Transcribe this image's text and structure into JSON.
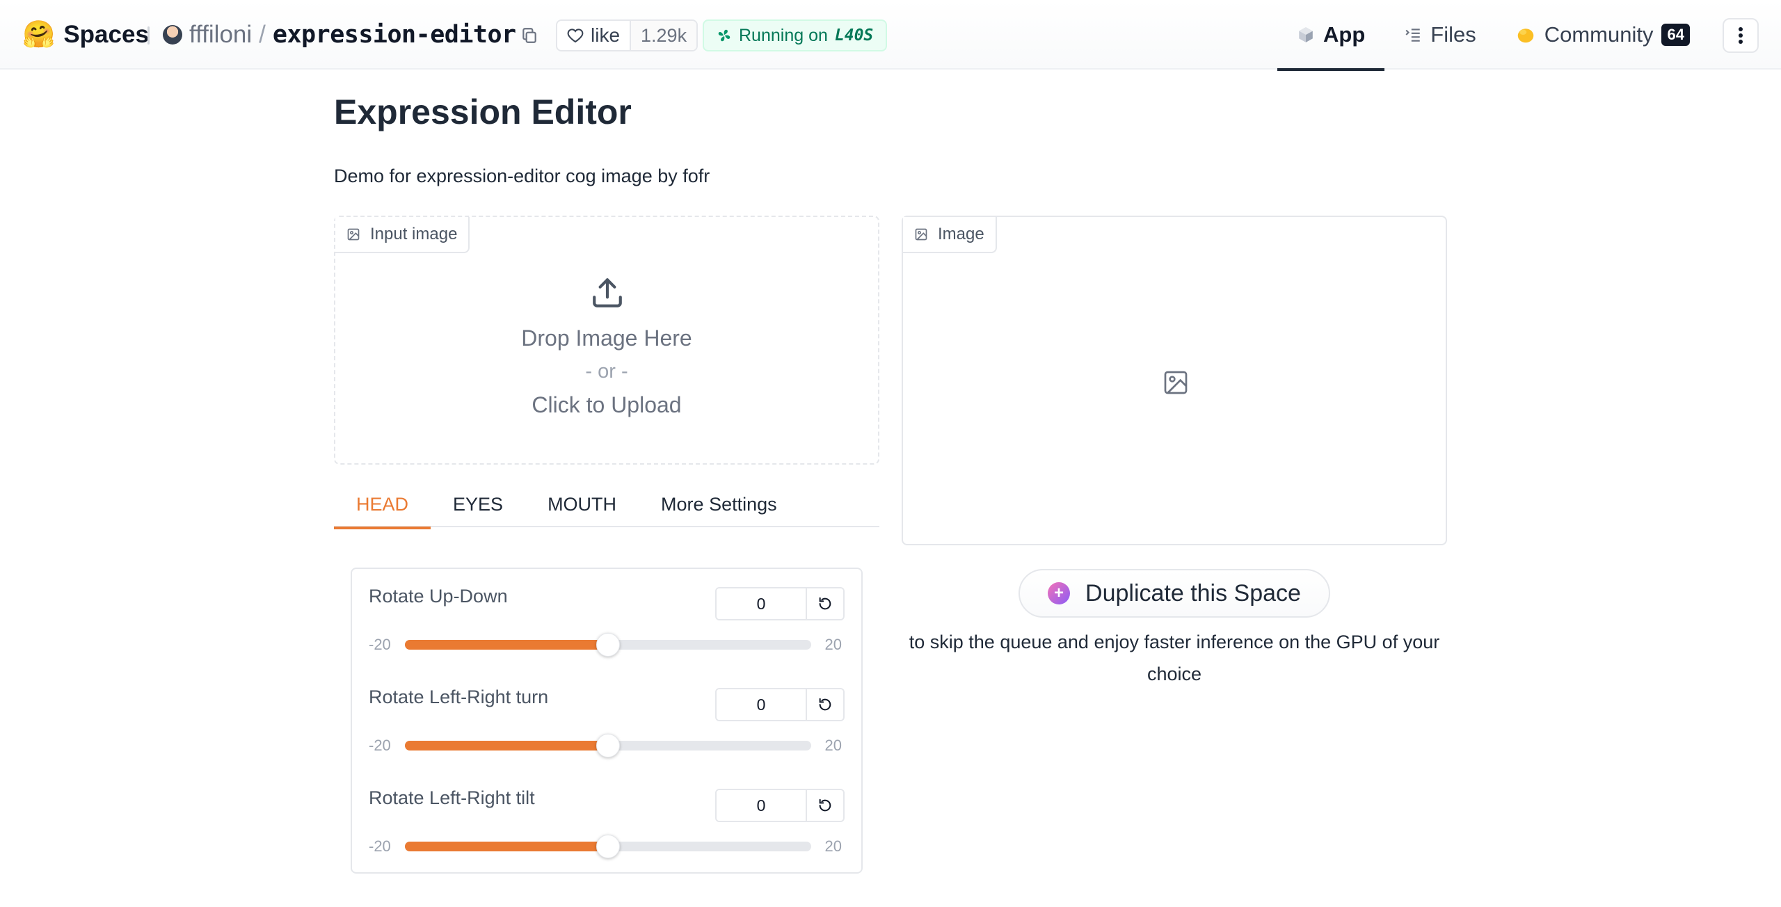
{
  "nav": {
    "brand_label": "Spaces",
    "brand_icon": "hugging-face-emoji",
    "owner": "fffiloni",
    "repo": "expression-editor",
    "like_label": "like",
    "like_count": "1.29k",
    "status_prefix": "Running on",
    "status_hardware": "L40S",
    "tabs": [
      {
        "label": "App",
        "icon": "cube-icon",
        "active": true
      },
      {
        "label": "Files",
        "icon": "files-icon",
        "active": false
      },
      {
        "label": "Community",
        "icon": "community-icon",
        "active": false,
        "badge": "64"
      }
    ]
  },
  "app": {
    "title": "Expression Editor",
    "description": "Demo for expression-editor cog image by fofr",
    "input_image": {
      "label": "Input image",
      "drop_text": "Drop Image Here",
      "or_text": "- or -",
      "click_text": "Click to Upload"
    },
    "output_image": {
      "label": "Image"
    },
    "tabs": [
      {
        "label": "HEAD",
        "active": true
      },
      {
        "label": "EYES",
        "active": false
      },
      {
        "label": "MOUTH",
        "active": false
      },
      {
        "label": "More Settings",
        "active": false
      }
    ],
    "sliders": [
      {
        "label": "Rotate Up-Down",
        "value": 0,
        "min": -20,
        "max": 20
      },
      {
        "label": "Rotate Left-Right turn",
        "value": 0,
        "min": -20,
        "max": 20
      },
      {
        "label": "Rotate Left-Right tilt",
        "value": 0,
        "min": -20,
        "max": 20
      }
    ],
    "duplicate": {
      "button_label": "Duplicate this Space",
      "subtitle": "to skip the queue and enjoy faster inference on the GPU of your choice"
    }
  },
  "colors": {
    "accent": "#ea7a32",
    "status_green": "#047857"
  }
}
